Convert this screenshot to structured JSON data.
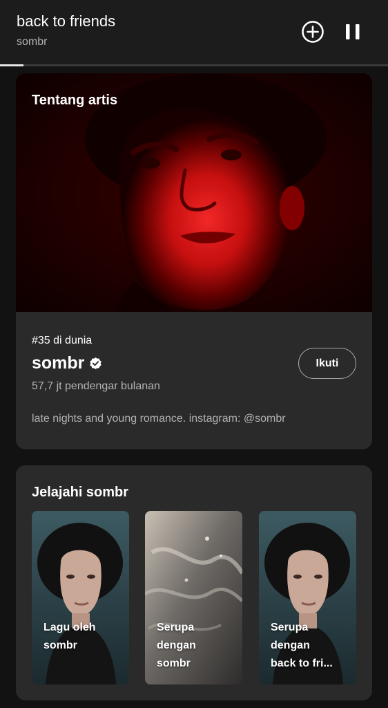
{
  "now_playing": {
    "title": "back to friends",
    "artist": "sombr",
    "progress_fraction": 0.06
  },
  "about": {
    "heading": "Tentang artis",
    "rank": "#35 di dunia",
    "name": "sombr",
    "monthly_listeners": "57,7 jt pendengar bulanan",
    "follow_label": "Ikuti",
    "bio": "late nights and young romance. instagram: @sombr"
  },
  "explore": {
    "heading": "Jelajahi sombr",
    "tiles": [
      {
        "line1": "Lagu oleh",
        "line2": "sombr",
        "line3": ""
      },
      {
        "line1": "Serupa",
        "line2": "dengan",
        "line3": "sombr"
      },
      {
        "line1": "Serupa",
        "line2": "dengan",
        "line3": "back to fri..."
      }
    ]
  },
  "icons": {
    "add": "plus-circle-icon",
    "pause": "pause-icon",
    "verified": "verified-badge-icon"
  },
  "colors": {
    "background": "#121212",
    "card": "#2a2a2a",
    "header": "#1c1c1c",
    "secondary_text": "#b3b3b3"
  }
}
